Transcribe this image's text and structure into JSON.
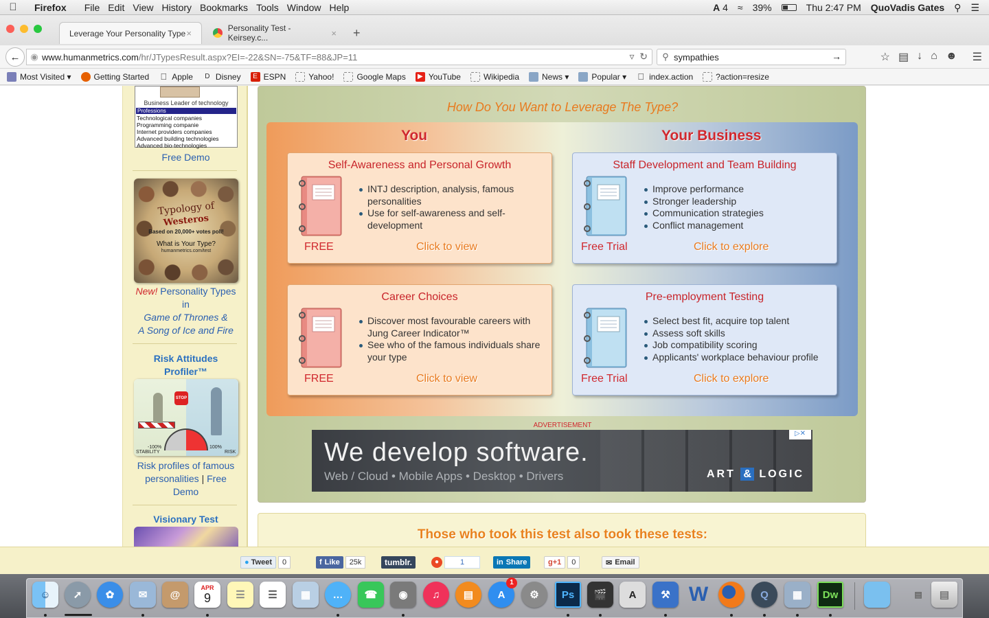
{
  "menubar": {
    "apple": "",
    "app": "Firefox",
    "items": [
      "File",
      "Edit",
      "View",
      "History",
      "Bookmarks",
      "Tools",
      "Window",
      "Help"
    ],
    "status": {
      "adobe_count": "4",
      "battery": "39%",
      "clock": "Thu 2:47 PM",
      "user": "QuoVadis Gates"
    }
  },
  "tabs": [
    {
      "title": "Leverage Your Personality Type",
      "close": "×"
    },
    {
      "title": "Personality Test - Keirsey.c...",
      "close": "×"
    }
  ],
  "new_tab": "+",
  "url": {
    "host": "www.humanmetrics.com",
    "path": "/hr/JTypesResult.aspx?EI=-22&SN=-75&TF=88&JP=11"
  },
  "search": {
    "value": "sympathies"
  },
  "bookmarks": [
    "Most Visited",
    "Getting Started",
    "Apple",
    "Disney",
    "ESPN",
    "Yahoo!",
    "Google Maps",
    "YouTube",
    "Wikipedia",
    "News",
    "Popular",
    "index.action",
    "?action=resize"
  ],
  "sidebar": {
    "widget": {
      "caption": "Business Leader of technology",
      "header": "Professions",
      "lines": [
        "Technological companies",
        "Programming companie",
        "Internet providers companies",
        "Advanced building technologies",
        "Advanced bio-technologies"
      ]
    },
    "free_demo_1": "Free Demo",
    "westeros": {
      "img_title_1": "Typology of",
      "img_title_2": "Westeros",
      "img_sub": "Based on 20,000+ votes poll!",
      "img_q": "What is Your Type?",
      "img_url": "humanmetrics.com/test",
      "new": "New!",
      "line1": "Personality Types",
      "line2": "in",
      "line3": "Game of Thrones &",
      "line4": "A Song of Ice and Fire"
    },
    "risk": {
      "title_1": "Risk Attitudes",
      "title_2": "Profiler™",
      "stop": "STOP",
      "left_pct": "-100%",
      "right_pct": "100%",
      "left_label": "STABILITY",
      "right_label": "RISK",
      "desc_1": "Risk profiles of famous",
      "desc_2": "personalities",
      "sep": "|",
      "desc_free": "Free",
      "desc_3": "Demo"
    },
    "visionary": "Visionary Test"
  },
  "main": {
    "title": "How Do You Want to Leverage The Type?",
    "col_you": "You",
    "col_biz": "Your Business",
    "cards": [
      {
        "title": "Self-Awareness and Personal Growth",
        "items": [
          "INTJ description, analysis, famous personalities",
          "Use for self-awareness and self-development"
        ],
        "tag": "FREE",
        "link": "Click to view"
      },
      {
        "title": "Staff Development and Team Building",
        "items": [
          "Improve performance",
          "Stronger leadership",
          "Communication strategies",
          "Conflict management"
        ],
        "tag": "Free Trial",
        "link": "Click to explore"
      },
      {
        "title": "Career Choices",
        "items": [
          "Discover most favourable careers with Jung Career Indicator™",
          "See who of the famous individuals share your type"
        ],
        "tag": "FREE",
        "link": "Click to view"
      },
      {
        "title": "Pre-employment Testing",
        "items": [
          "Select best fit, acquire top talent",
          "Assess soft skills",
          "Job compatibility scoring",
          "Applicants' workplace behaviour profile"
        ],
        "tag": "Free Trial",
        "link": "Click to explore"
      }
    ],
    "ad_label": "ADVERTISEMENT",
    "ad": {
      "headline": "We develop software.",
      "sub": "Web / Cloud • Mobile Apps • Desktop • Drivers",
      "logo_a": "ART",
      "logo_amp": "&",
      "logo_b": "LOGIC"
    },
    "also": "Those who took this test also took these tests:"
  },
  "share": {
    "tweet": "Tweet",
    "tweet_count": "0",
    "like": "Like",
    "like_count": "25k",
    "tumblr": "tumblr.",
    "stumble_count": "1",
    "linkedin": "Share",
    "gplus": "g+1",
    "gplus_count": "0",
    "email": "Email"
  },
  "dock": {
    "calendar_month": "APR",
    "calendar_day": "9",
    "appstore_badge": "1"
  },
  "colors": {
    "accent_red": "#d0282e",
    "accent_orange": "#e87a1e",
    "link_blue": "#2a5fb0",
    "sidebar_bg": "#f6f1c9"
  }
}
